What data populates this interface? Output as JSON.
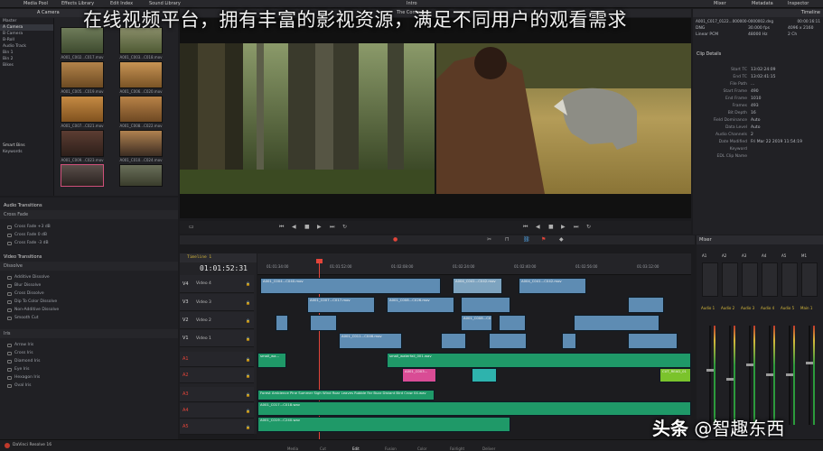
{
  "overlay_caption": "在线视频平台，拥有丰富的影视资源，满足不同用户的观看需求",
  "watermark": {
    "prefix": "头条",
    "handle": "@智趣东西"
  },
  "topbar": {
    "media_pool": "Media Pool",
    "effects_library": "Effects Library",
    "edit_index": "Edit Index",
    "sound_library": "Sound Library",
    "project_title": "Intro",
    "inspector": "Inspector",
    "mixer": "Mixer",
    "metadata": "Metadata"
  },
  "media_pool": {
    "bin_title": "A Camera",
    "master_label": "Master",
    "bins": [
      "A Camera",
      "B Camera",
      "B-Roll",
      "Audio Track",
      "Bin 1",
      "Bin 2",
      "Bikes"
    ],
    "smart_bins_label": "Smart Bins",
    "smart_bins": [
      "Keywords"
    ],
    "thumb_labels": [
      "A001_C002...C017.mov",
      "A001_C003...C018.mov",
      "A001_C005...C019.mov",
      "A001_C006...C020.mov",
      "A001_C007...C021.mov",
      "A001_C008...C022.mov",
      "A001_C009...C023.mov",
      "A001_C010...C024.mov",
      "",
      ""
    ]
  },
  "effects": {
    "audio_transitions_title": "Audio Transitions",
    "crossfade_section": "Cross Fade",
    "audio_items": [
      "Cross Fade +3 dB",
      "Cross Fade 0 dB",
      "Cross Fade -3 dB"
    ],
    "video_transitions_title": "Video Transitions",
    "dissolve_section": "Dissolve",
    "video_items": [
      "Additive Dissolve",
      "Blur Dissolve",
      "Cross Dissolve",
      "Dip To Color Dissolve",
      "Non-Additive Dissolve",
      "Smooth Cut"
    ],
    "iris_section": "Iris",
    "iris_items": [
      "Arrow Iris",
      "Cross Iris",
      "Diamond Iris",
      "Eye Iris",
      "Hexagon Iris",
      "Oval Iris"
    ]
  },
  "viewer": {
    "program_title": "The Comment",
    "timeline_label": "Timeline 1"
  },
  "metadata": {
    "panel_title": "Timeline",
    "clip_name": "A001_C017_0122...000000-0000002.dng",
    "timecode": "00:00:16:11",
    "row1": {
      "label": "DNG",
      "value": "30.000 fps",
      "extra": "4096 x 2160"
    },
    "row2": {
      "label": "Linear PCM",
      "value": "48000 Hz",
      "extra": "2 Ch"
    },
    "clip_details_title": "Clip Details",
    "details": [
      {
        "k": "Start TC",
        "v": "13:02:24:09"
      },
      {
        "k": "End TC",
        "v": "13:02:41:15"
      },
      {
        "k": "File Path",
        "v": "..."
      },
      {
        "k": "Start Frame",
        "v": "490"
      },
      {
        "k": "End Frame",
        "v": "1010"
      },
      {
        "k": "Frames",
        "v": "493"
      },
      {
        "k": "Bit Depth",
        "v": "16"
      },
      {
        "k": "Field Dominance",
        "v": "Auto"
      },
      {
        "k": "Data Level",
        "v": "Auto"
      },
      {
        "k": "Audio Channels",
        "v": "2"
      },
      {
        "k": "Date Modified",
        "v": "Fri Mar 22 2019 11:54:19"
      },
      {
        "k": "Keyword",
        "v": ""
      },
      {
        "k": "EDL Clip Name",
        "v": ""
      }
    ]
  },
  "timeline": {
    "name": "Timeline 1",
    "timecode": "01:01:52:31",
    "ruler": [
      "01:01:34:00",
      "01:01:52:00",
      "01:02:08:00",
      "01:02:24:00",
      "01:02:40:00",
      "01:02:56:00",
      "01:03:12:00"
    ],
    "tracks": [
      {
        "id": "V4",
        "name": "Video 4"
      },
      {
        "id": "V3",
        "name": "Video 3"
      },
      {
        "id": "V2",
        "name": "Video 2"
      },
      {
        "id": "V1",
        "name": "Video 1"
      },
      {
        "id": "A1",
        "name": ""
      },
      {
        "id": "A2",
        "name": ""
      },
      {
        "id": "A3",
        "name": ""
      },
      {
        "id": "A4",
        "name": ""
      },
      {
        "id": "A5",
        "name": ""
      }
    ],
    "clip_labels": {
      "v4_a": "A001_C004...C040.mov",
      "v4_b": "A004_C041...C042.mov",
      "v3_a": "A001_C007...C017.mov",
      "v3_b": "A001_C008...C026.mov",
      "v2_a": "A001_C008...C021.mov",
      "v1_a": "A001_C011...C046.mov",
      "a1_a": "small_wa...",
      "a1_b": "small_waterfall_001.wav",
      "a2_a": "A001_C003...",
      "a2_b": "CUT_READ_01",
      "a3_a": "Forest Ambience Pine Summer Sigh Wind Roar Leaves Rubble Far Buzz Distant Bird Crow 04.wav",
      "a4_a": "A001_C017...C018.wav",
      "a5_a": "A001_C019...C240.wav"
    }
  },
  "mixer": {
    "title": "Mixer",
    "channels": [
      "A1",
      "A2",
      "A3",
      "A4",
      "A5",
      "M1"
    ],
    "strips": [
      "Audio 1",
      "Audio 2",
      "Audio 3",
      "Audio 4",
      "Audio 5",
      "Main 1"
    ],
    "fader_levels": [
      0.55,
      0.45,
      0.6,
      0.5,
      0.5,
      0.62
    ]
  },
  "bottombar": {
    "app_name": "DaVinci Resolve 16",
    "pages": [
      "Media",
      "Cut",
      "Edit",
      "Fusion",
      "Color",
      "Fairlight",
      "Deliver"
    ]
  },
  "colors": {
    "video_clip": "#5e8cb3",
    "audio_clip": "#1f9968",
    "playhead": "#e3453a",
    "accent": "#d6b83a"
  }
}
